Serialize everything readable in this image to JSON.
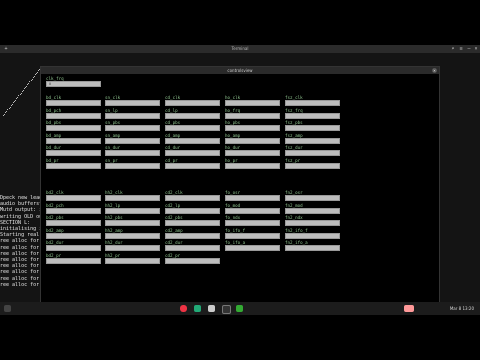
{
  "window": {
    "title": "Terminal",
    "app_title": "controlsview"
  },
  "terminal_lines": [
    "Dpeck new leade",
    "audio bufferst",
    "Mutd output: i",
    "writing OLD ou",
    "SECTION L:",
    "initialising i",
    "Starting real",
    "ree alloc for",
    "ree alloc for",
    "ree alloc for",
    "ree alloc for",
    "ree alloc for",
    "ree alloc for",
    "ree alloc for",
    "ree alloc for"
  ],
  "controls_top": [
    {
      "label": "clk_frq",
      "value": "0"
    },
    {
      "label": "bd_clk",
      "value": ""
    },
    {
      "label": "sn_clk",
      "value": ""
    },
    {
      "label": "cd_clk",
      "value": ""
    },
    {
      "label": "ho_clk",
      "value": ""
    },
    {
      "label": "fsz_clk",
      "value": ""
    },
    {
      "label": "bd_pch",
      "value": ""
    },
    {
      "label": "sn_lp",
      "value": ""
    },
    {
      "label": "cd_lp",
      "value": ""
    },
    {
      "label": "ho_frq",
      "value": ""
    },
    {
      "label": "fsz_frq",
      "value": ""
    },
    {
      "label": "bd_pbs",
      "value": ""
    },
    {
      "label": "sn_pbs",
      "value": ""
    },
    {
      "label": "cd_pbs",
      "value": ""
    },
    {
      "label": "ho_pbs",
      "value": ""
    },
    {
      "label": "fsz_pbs",
      "value": ""
    },
    {
      "label": "bd_amp",
      "value": ""
    },
    {
      "label": "sn_amp",
      "value": ""
    },
    {
      "label": "cd_amp",
      "value": ""
    },
    {
      "label": "ho_amp",
      "value": ""
    },
    {
      "label": "fsz_amp",
      "value": ""
    },
    {
      "label": "bd_dur",
      "value": ""
    },
    {
      "label": "sn_dur",
      "value": ""
    },
    {
      "label": "cd_dur",
      "value": ""
    },
    {
      "label": "ho_dur",
      "value": ""
    },
    {
      "label": "fsz_dur",
      "value": ""
    },
    {
      "label": "bd_pr",
      "value": ""
    },
    {
      "label": "sn_pr",
      "value": ""
    },
    {
      "label": "cd_pr",
      "value": ""
    },
    {
      "label": "ho_pr",
      "value": ""
    },
    {
      "label": "fsz_pr",
      "value": ""
    }
  ],
  "controls_bottom": [
    {
      "label": "bd2_clk",
      "value": ""
    },
    {
      "label": "hh2_clk",
      "value": ""
    },
    {
      "label": "cd2_clk",
      "value": ""
    },
    {
      "label": "fo_osr",
      "value": ""
    },
    {
      "label": "fn2_osr",
      "value": ""
    },
    {
      "label": "bd2_pch",
      "value": ""
    },
    {
      "label": "hh2_lp",
      "value": ""
    },
    {
      "label": "cd2_lp",
      "value": ""
    },
    {
      "label": "fo_mod",
      "value": ""
    },
    {
      "label": "fn2_mod",
      "value": ""
    },
    {
      "label": "bd2_pbs",
      "value": ""
    },
    {
      "label": "hh2_pbs",
      "value": ""
    },
    {
      "label": "cd2_pbs",
      "value": ""
    },
    {
      "label": "fo_ndx",
      "value": ""
    },
    {
      "label": "fn2_ndx",
      "value": ""
    },
    {
      "label": "bd2_amp",
      "value": ""
    },
    {
      "label": "hh2_amp",
      "value": ""
    },
    {
      "label": "cd2_amp",
      "value": ""
    },
    {
      "label": "fo_ifo_f",
      "value": ""
    },
    {
      "label": "fn2_ifo_f",
      "value": ""
    },
    {
      "label": "bd2_dur",
      "value": ""
    },
    {
      "label": "hh2_dur",
      "value": ""
    },
    {
      "label": "cd2_dur",
      "value": ""
    },
    {
      "label": "fo_ifo_a",
      "value": ""
    },
    {
      "label": "fn2_ifo_a",
      "value": ""
    },
    {
      "label": "bd2_pr",
      "value": ""
    },
    {
      "label": "hh2_pr",
      "value": ""
    },
    {
      "label": "cd2_pr",
      "value": ""
    }
  ],
  "taskbar": {
    "clock": "Mar 8 13:20"
  }
}
